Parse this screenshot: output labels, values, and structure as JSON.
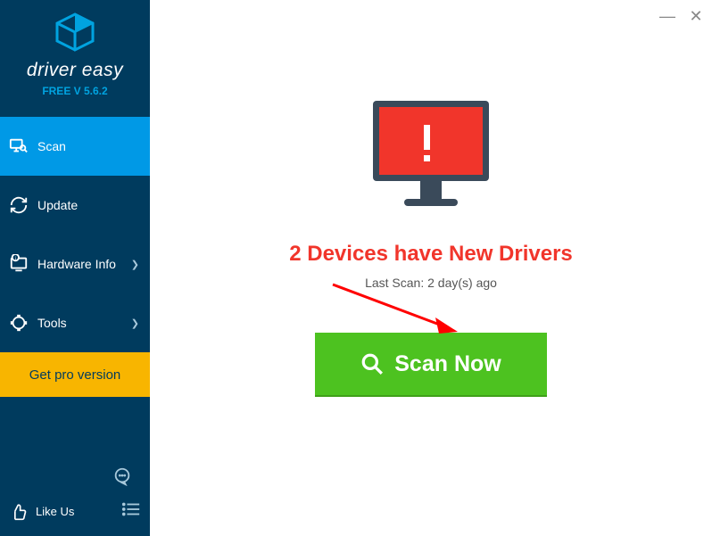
{
  "app": {
    "brand": "driver easy",
    "version": "FREE V 5.6.2"
  },
  "sidebar": {
    "items": [
      {
        "label": "Scan",
        "active": true,
        "hasSub": false
      },
      {
        "label": "Update",
        "active": false,
        "hasSub": false
      },
      {
        "label": "Hardware Info",
        "active": false,
        "hasSub": true
      },
      {
        "label": "Tools",
        "active": false,
        "hasSub": true
      }
    ],
    "pro_label": "Get pro version",
    "like_label": "Like Us"
  },
  "main": {
    "headline": "2 Devices have New Drivers",
    "last_scan": "Last Scan: 2 day(s) ago",
    "scan_button": "Scan Now"
  },
  "colors": {
    "sidebar_bg": "#003b5e",
    "accent": "#0099e6",
    "pro_bg": "#f8b500",
    "alert_red": "#f1352b",
    "scan_green": "#4dc220"
  }
}
